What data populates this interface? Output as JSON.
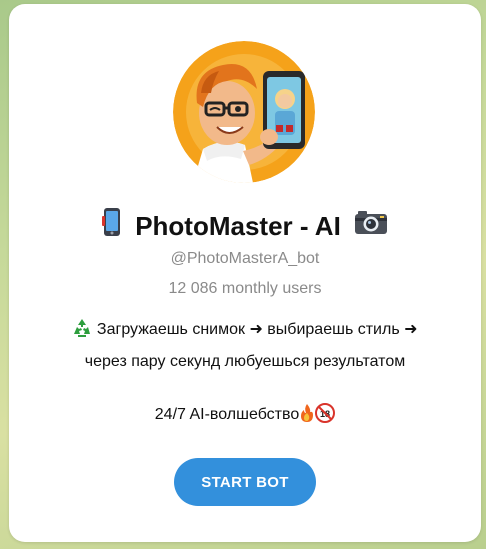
{
  "profile": {
    "title_prefix_icon": "mobile-phone-icon",
    "title": "PhotoMaster - AI",
    "title_suffix_icon": "camera-icon",
    "username": "@PhotoMasterA_bot",
    "monthly_users": "12 086 monthly users",
    "avatar_icon": "cartoon-man-selfie-avatar"
  },
  "description": {
    "line1_icon": "recycle-icon",
    "line1": "Загружаешь снимок ➜ выбираешь стиль ➜",
    "line2": "через пару секунд любуешься результатом",
    "tagline": "24/7 AI-волшебство",
    "tagline_icons": [
      "fire-icon",
      "no-under-18-icon"
    ]
  },
  "actions": {
    "start_label": "START BOT"
  },
  "colors": {
    "accent": "#3390dc",
    "muted_text": "#8a8a8a",
    "card_bg": "#ffffff",
    "avatar_bg": "#f5a21a"
  }
}
